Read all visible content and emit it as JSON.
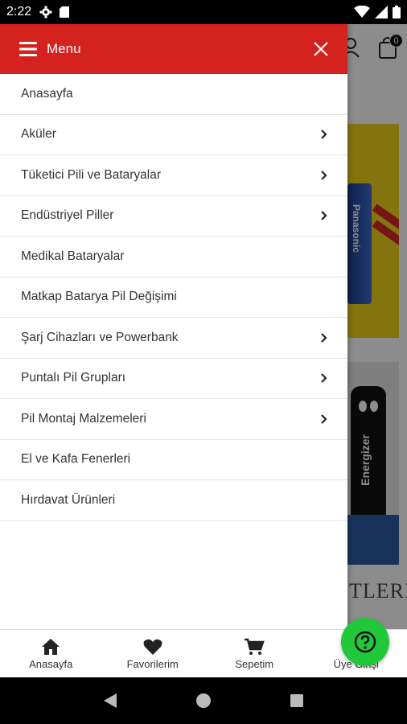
{
  "status_bar": {
    "time": "2:22"
  },
  "header": {
    "cart_count": "0"
  },
  "banners": {
    "panasonic_text": "Panasonic",
    "energizer_text": "Energizer",
    "partial_heading": "TLERİ"
  },
  "drawer": {
    "title": "Menu",
    "items": [
      {
        "label": "Anasayfa",
        "has_children": false
      },
      {
        "label": "Aküler",
        "has_children": true
      },
      {
        "label": "Tüketici Pili ve Bataryalar",
        "has_children": true
      },
      {
        "label": "Endüstriyel Piller",
        "has_children": true
      },
      {
        "label": "Medikal Bataryalar",
        "has_children": false
      },
      {
        "label": "Matkap Batarya Pil Değişimi",
        "has_children": false
      },
      {
        "label": "Şarj Cihazları ve Powerbank",
        "has_children": true
      },
      {
        "label": "Puntalı Pil Grupları",
        "has_children": true
      },
      {
        "label": "Pil Montaj Malzemeleri",
        "has_children": true
      },
      {
        "label": "El ve Kafa Fenerleri",
        "has_children": false
      },
      {
        "label": "Hırdavat Ürünleri",
        "has_children": false
      }
    ]
  },
  "tabbar": {
    "tabs": [
      {
        "label": "Anasayfa",
        "icon": "home-icon"
      },
      {
        "label": "Favorilerim",
        "icon": "heart-icon"
      },
      {
        "label": "Sepetim",
        "icon": "cart-icon"
      },
      {
        "label": "Üye Girişi",
        "icon": "user-icon"
      }
    ]
  },
  "colors": {
    "brand_red": "#d4231f",
    "help_green": "#21c93a"
  }
}
